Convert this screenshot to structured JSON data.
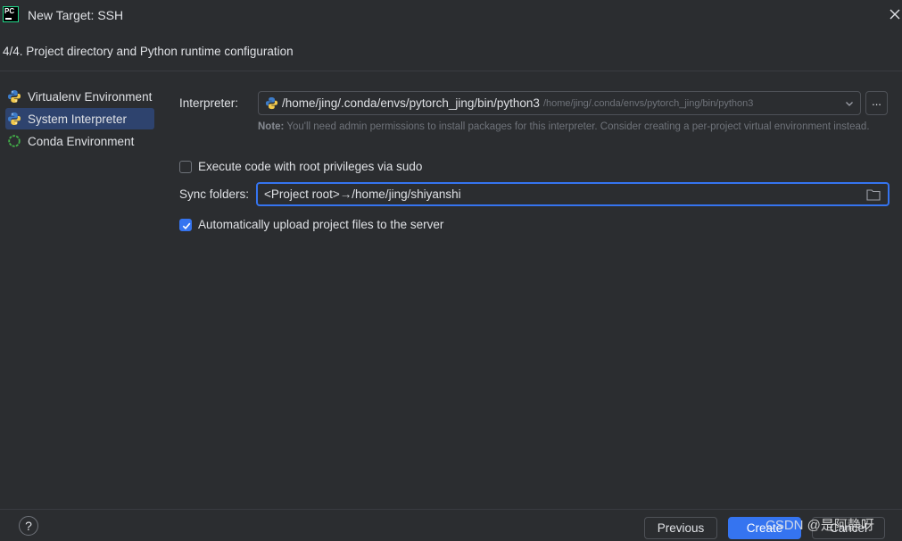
{
  "window": {
    "title": "New Target: SSH",
    "app_logo_text": "PC"
  },
  "header": {
    "step": "4/4. Project directory and Python runtime configuration"
  },
  "sidebar": {
    "items": [
      {
        "label": "Virtualenv Environment",
        "icon": "python-icon",
        "selected": false
      },
      {
        "label": "System Interpreter",
        "icon": "python-icon",
        "selected": true
      },
      {
        "label": "Conda Environment",
        "icon": "conda-icon",
        "selected": false
      }
    ]
  },
  "form": {
    "interpreter_label": "Interpreter:",
    "interpreter_value": "/home/jing/.conda/envs/pytorch_jing/bin/python3",
    "interpreter_subpath": "/home/jing/.conda/envs/pytorch_jing/bin/python3",
    "browse_label": "...",
    "note_bold": "Note:",
    "note_text": " You'll need admin permissions to install packages for this interpreter. Consider creating a per-project virtual environment instead.",
    "sudo_label": "Execute code with root privileges via sudo",
    "sudo_checked": false,
    "sync_label": "Sync folders:",
    "sync_value": "<Project root>→/home/jing/shiyanshi",
    "upload_label": "Automatically upload project files to the server",
    "upload_checked": true
  },
  "footer": {
    "help_label": "?",
    "previous_label": "Previous",
    "create_label": "Create",
    "cancel_label": "Cancel",
    "watermark": "CSDN @是阿静呀"
  },
  "colors": {
    "background": "#2b2d30",
    "accent": "#3574f0",
    "selected_item": "#2e436e",
    "text": "#dfe1e5",
    "muted_text": "#6f737a"
  }
}
